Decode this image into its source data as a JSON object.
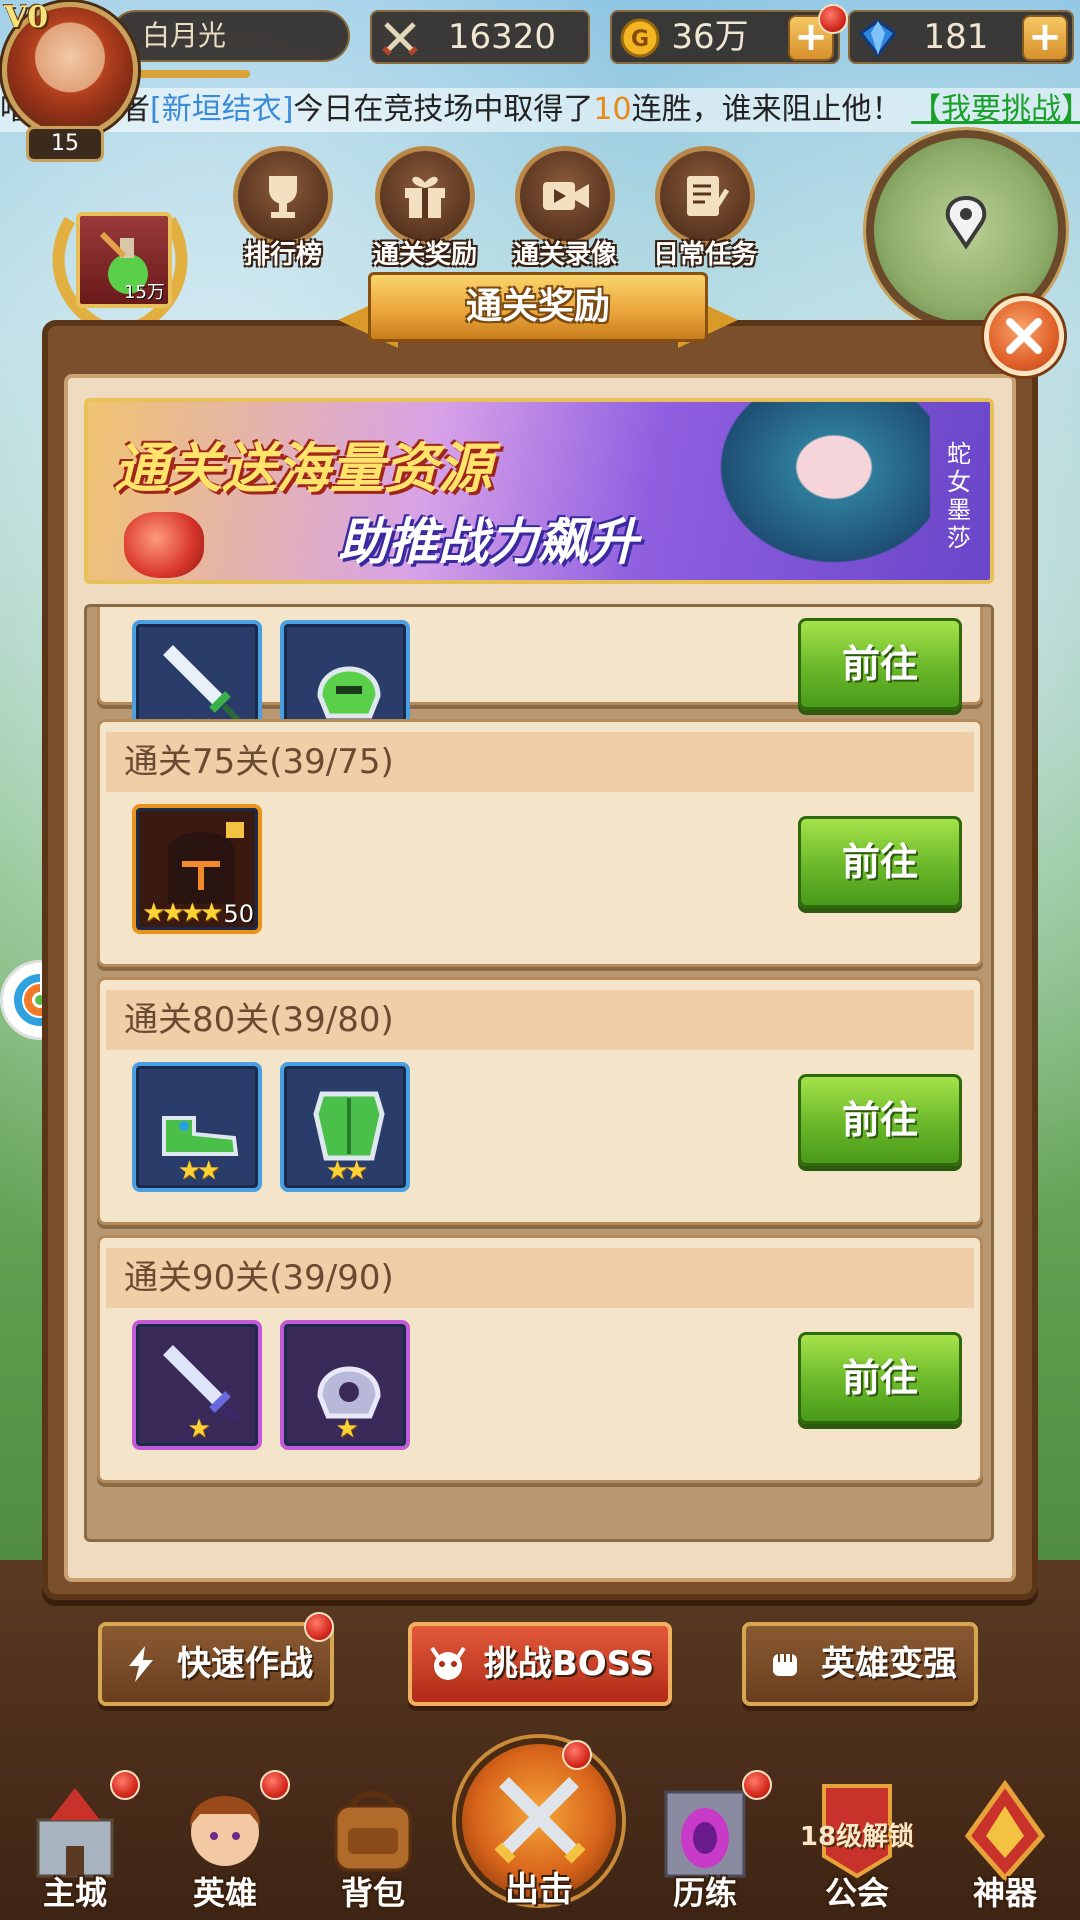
{
  "player": {
    "vip": "V0",
    "name": "白月光",
    "level": "15"
  },
  "resources": {
    "power": "16320",
    "gold": "36万",
    "gems": "181"
  },
  "marquee": {
    "prefix": "噜！冒险者",
    "player": "[新垣结衣]",
    "middle": "今日在竞技场中取得了",
    "count": "10",
    "suffix": "连胜，谁来阻止他！",
    "challenge": "【我要挑战】"
  },
  "features": [
    {
      "label": "排行榜",
      "icon": "trophy-icon"
    },
    {
      "label": "通关奖励",
      "icon": "gift-icon"
    },
    {
      "label": "通关录像",
      "icon": "video-icon"
    },
    {
      "label": "日常任务",
      "icon": "task-icon"
    }
  ],
  "wreath_item": {
    "count": "15万",
    "icon": "potion-icon"
  },
  "dialog": {
    "title": "通关奖励",
    "banner": {
      "line1": "通关送海量资源",
      "line2": "助推战力飙升",
      "side_label": "蛇女墨莎"
    },
    "go_label": "前往",
    "rewards": [
      {
        "header": "",
        "items": [
          {
            "type": "blue",
            "icon": "sword-icon",
            "stars": "★★"
          },
          {
            "type": "blue",
            "icon": "helmet-icon",
            "stars": "★★"
          }
        ]
      },
      {
        "header": "通关75关(39/75)",
        "items": [
          {
            "type": "orange",
            "icon": "hero-fragment-icon",
            "stars": "★★★★",
            "count": "50"
          }
        ]
      },
      {
        "header": "通关80关(39/80)",
        "items": [
          {
            "type": "blue",
            "icon": "boots-icon",
            "stars": "★★"
          },
          {
            "type": "blue",
            "icon": "armor-icon",
            "stars": "★★"
          }
        ]
      },
      {
        "header": "通关90关(39/90)",
        "items": [
          {
            "type": "purple",
            "icon": "sword-icon",
            "stars": "★"
          },
          {
            "type": "purple",
            "icon": "helmet-icon",
            "stars": "★"
          }
        ]
      }
    ]
  },
  "actions": {
    "quick_battle": "快速作战",
    "challenge_boss": "挑战BOSS",
    "hero_upgrade": "英雄变强"
  },
  "nav": {
    "main_city": "主城",
    "heroes": "英雄",
    "bag": "背包",
    "attack": "出击",
    "trial": "历练",
    "guild": "公会",
    "guild_lock": "18级解锁",
    "artifact": "神器"
  },
  "colors": {
    "go_button": "#6ab82a",
    "dialog_bg": "#efdcc0",
    "title_ribbon": "#eaa33a",
    "red_dot": "#d42a1e"
  }
}
